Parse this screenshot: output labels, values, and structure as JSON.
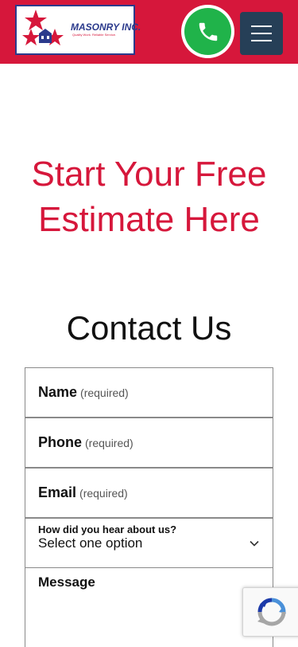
{
  "header": {
    "logo_text": "MASONRY INC.",
    "logo_tagline": "Quality Work. Reliable Service.",
    "brand_color": "#d6173b",
    "phone_color": "#20b34a",
    "menu_color": "#263f57"
  },
  "hero": {
    "title": "Start Your Free Estimate Here"
  },
  "contact": {
    "title": "Contact Us",
    "fields": [
      {
        "label": "Name",
        "required": "(required)"
      },
      {
        "label": "Phone",
        "required": "(required)"
      },
      {
        "label": "Email",
        "required": "(required)"
      }
    ],
    "source": {
      "label": "How did you hear about us?",
      "value": "Select one option"
    },
    "message_label": "Message"
  }
}
